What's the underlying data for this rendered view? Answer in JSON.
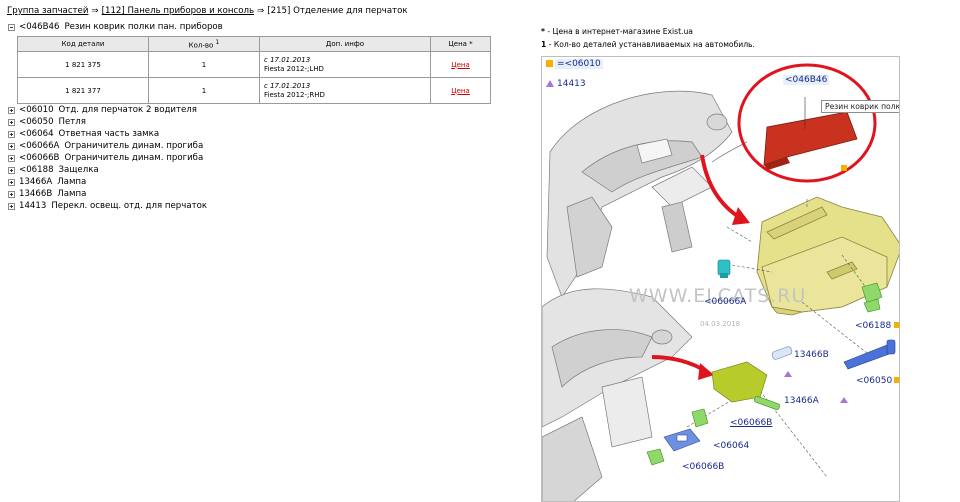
{
  "breadcrumb": {
    "root": "Группа запчастей",
    "level1": "[112] Панель приборов и консоль",
    "level2": "[215] Отделение для перчаток",
    "separator": "⇒"
  },
  "current_group": {
    "code": "<046B46",
    "name": "Резин коврик полки пан. приборов"
  },
  "table": {
    "headers": {
      "code": "Код детали",
      "qty": "Кол-во",
      "qty_sup": "1",
      "info": "Доп. инфо",
      "price": "Цена *"
    },
    "rows": [
      {
        "code": "1 821 375",
        "qty": "1",
        "info_date": "с 17.01.2013",
        "info_model": "Fiesta 2012-;LHD",
        "price": "Цена"
      },
      {
        "code": "1 821 377",
        "qty": "1",
        "info_date": "с 17.01.2013",
        "info_model": "Fiesta 2012-;RHD",
        "price": "Цена"
      }
    ]
  },
  "groups": [
    {
      "code": "<06010",
      "name": "Отд. для перчаток 2 водителя"
    },
    {
      "code": "<06050",
      "name": "Петля"
    },
    {
      "code": "<06064",
      "name": "Ответная часть замка"
    },
    {
      "code": "<06066A",
      "name": "Ограничитель динам. прогиба"
    },
    {
      "code": "<06066B",
      "name": "Ограничитель динам. прогиба"
    },
    {
      "code": "<06188",
      "name": "Защелка"
    },
    {
      "code": "13466A",
      "name": "Лампа"
    },
    {
      "code": "13466B",
      "name": "Лампа"
    },
    {
      "code": "14413",
      "name": "Перекл. освещ. отд. для перчаток"
    }
  ],
  "notes": {
    "star_mark": "*",
    "star_text": "- Цена в интернет-магазине Exist.ua",
    "one_mark": "1",
    "one_text": "- Кол-во деталей устанавливаемых на автомобиль."
  },
  "diagram": {
    "legend_square": "=<06010",
    "legend_triangle": "14413",
    "highlight_code": "<046B46",
    "callout": "Резин коврик полки пан. приборов",
    "labels": {
      "p06066a": "<06066A",
      "p06188": "<06188",
      "p13466b": "13466B",
      "p06050": "<06050",
      "p13466a": "13466A",
      "p06066b_top": "<06066B",
      "p06064": "<06064",
      "p06066b_bottom": "<06066B"
    },
    "watermark": "WWW.ELCATS.RU",
    "watermark_date": "04.03.2018"
  },
  "colors": {
    "price_link": "#d40000",
    "diagram_label": "#1a2a8a",
    "highlight_circle": "#e0141e",
    "mat_part": "#c8321f",
    "glovebox": "#e5e08a",
    "legend_square": "#f5b000",
    "legend_triangle": "#a775d6"
  }
}
